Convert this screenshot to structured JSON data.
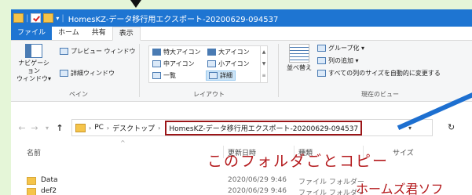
{
  "window": {
    "title": "HomesKZ-データ移行用エクスポート-20200629-094537"
  },
  "ribbon": {
    "tabs": [
      "ファイル",
      "ホーム",
      "共有",
      "表示"
    ],
    "panes": {
      "nav_pane": "ナビゲーション\nウィンドウ▾",
      "preview": "プレビュー ウィンドウ",
      "details": "詳細ウィンドウ",
      "group": "ペイン"
    },
    "layout": {
      "items": [
        "特大アイコン",
        "大アイコン",
        "中アイコン",
        "小アイコン",
        "一覧",
        "詳細"
      ],
      "group": "レイアウト"
    },
    "view": {
      "sort": "並べ替え",
      "group_by": "グループ化 ▾",
      "add_column": "列の追加 ▾",
      "autosize": "すべての列のサイズを自動的に変更する",
      "group": "現在のビュー"
    }
  },
  "address": {
    "crumbs": [
      "PC",
      "デスクトップ"
    ],
    "current": "HomesKZ-データ移行用エクスポート-20200629-094537"
  },
  "list": {
    "columns": [
      "名前",
      "更新日時",
      "種類",
      "サイズ"
    ],
    "rows": [
      {
        "name": "Data",
        "date": "2020/06/29 9:46",
        "type": "ファイル フォルダー"
      },
      {
        "name": "def2",
        "date": "2020/06/29 9:46",
        "type": "ファイル フォルダー"
      }
    ]
  },
  "annotations": {
    "copy": "このフォルダごとコピー",
    "software": "ホームズ君ソフ"
  }
}
